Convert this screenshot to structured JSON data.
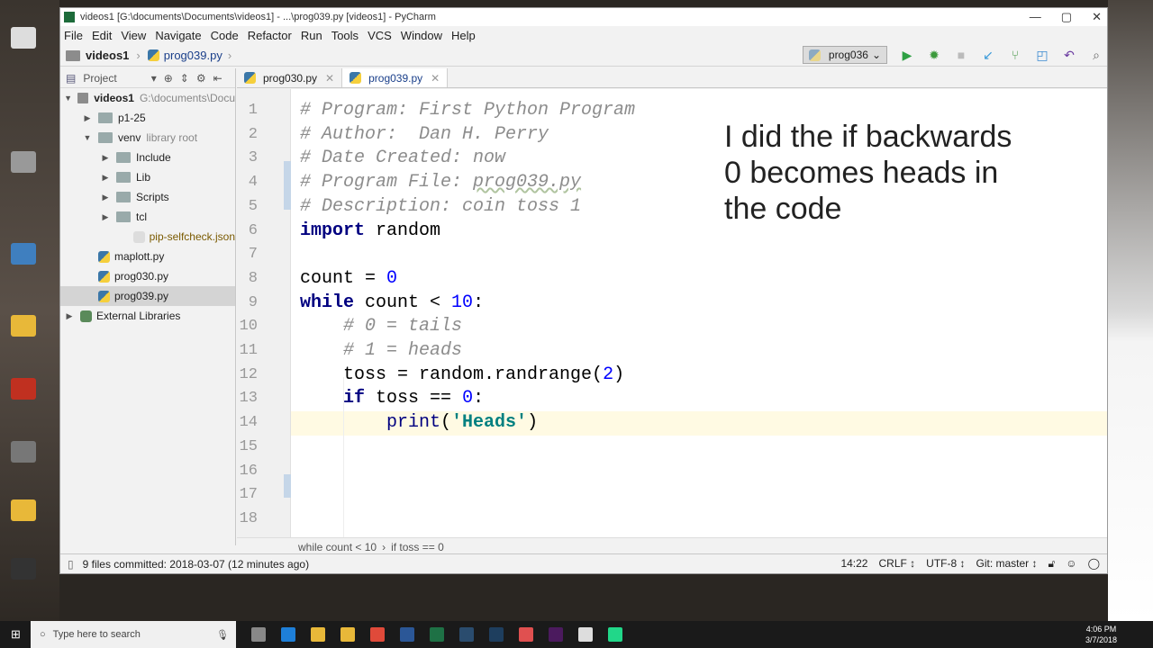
{
  "window": {
    "title": "videos1 [G:\\documents\\Documents\\videos1] - ...\\prog039.py [videos1] - PyCharm",
    "controls": [
      "—",
      "▢",
      "✕"
    ]
  },
  "menu": [
    "File",
    "Edit",
    "View",
    "Navigate",
    "Code",
    "Refactor",
    "Run",
    "Tools",
    "VCS",
    "Window",
    "Help"
  ],
  "nav": {
    "project": "videos1",
    "file": "prog039.py"
  },
  "toolbar": {
    "run_config": "prog036",
    "icons": [
      "run-icon",
      "debug-icon",
      "stop-icon",
      "vcs-update-icon",
      "vcs-commit-icon",
      "history-icon",
      "revert-icon",
      "search-icon"
    ]
  },
  "sidebar": {
    "title": "Project",
    "items": [
      {
        "label": "videos1",
        "hint": "G:\\documents\\Docu",
        "depth": 0,
        "arrow": "down",
        "type": "folder",
        "bold": true
      },
      {
        "label": "p1-25",
        "depth": 1,
        "arrow": "right",
        "type": "folder"
      },
      {
        "label": "venv",
        "hint": "library root",
        "depth": 1,
        "arrow": "down",
        "type": "folder"
      },
      {
        "label": "Include",
        "depth": 2,
        "arrow": "right",
        "type": "folder"
      },
      {
        "label": "Lib",
        "depth": 2,
        "arrow": "right",
        "type": "folder"
      },
      {
        "label": "Scripts",
        "depth": 2,
        "arrow": "right",
        "type": "folder"
      },
      {
        "label": "tcl",
        "depth": 2,
        "arrow": "right",
        "type": "folder"
      },
      {
        "label": "pip-selfcheck.json",
        "depth": 3,
        "type": "json",
        "color": "#7a5a00"
      },
      {
        "label": "maplott.py",
        "depth": 1,
        "type": "py"
      },
      {
        "label": "prog030.py",
        "depth": 1,
        "type": "py"
      },
      {
        "label": "prog039.py",
        "depth": 1,
        "type": "py",
        "selected": true
      },
      {
        "label": "External Libraries",
        "depth": 0,
        "arrow": "right",
        "type": "lib"
      }
    ]
  },
  "tabs": [
    {
      "label": "prog030.py",
      "active": false
    },
    {
      "label": "prog039.py",
      "active": true
    }
  ],
  "code": [
    [
      [
        "comment",
        "# Program: First Python Program"
      ]
    ],
    [
      [
        "comment",
        "# Author:  Dan H. Perry"
      ]
    ],
    [
      [
        "comment",
        "# Date Created: now"
      ]
    ],
    [
      [
        "comment",
        "# Program File: "
      ],
      [
        "comment under",
        "prog039.py"
      ]
    ],
    [
      [
        "comment",
        "# Description: coin toss 1"
      ]
    ],
    [
      [
        "kw",
        "import"
      ],
      [
        "plain",
        " random"
      ]
    ],
    [],
    [
      [
        "plain",
        "count = "
      ],
      [
        "num",
        "0"
      ]
    ],
    [
      [
        "kw",
        "while"
      ],
      [
        "plain",
        " count < "
      ],
      [
        "num",
        "10"
      ],
      [
        "plain",
        ":"
      ]
    ],
    [
      [
        "plain",
        "    "
      ],
      [
        "comment",
        "# 0 = tails"
      ]
    ],
    [
      [
        "plain",
        "    "
      ],
      [
        "comment",
        "# 1 = heads"
      ]
    ],
    [
      [
        "plain",
        "    toss = random.randrange("
      ],
      [
        "num",
        "2"
      ],
      [
        "plain",
        ")"
      ]
    ],
    [
      [
        "plain",
        "    "
      ],
      [
        "kw",
        "if"
      ],
      [
        "plain",
        " toss == "
      ],
      [
        "num",
        "0"
      ],
      [
        "plain",
        ":"
      ]
    ],
    [
      [
        "plain",
        "        "
      ],
      [
        "builtin",
        "print"
      ],
      [
        "plain",
        "("
      ],
      [
        "str",
        "'Heads'"
      ],
      [
        "plain",
        ")"
      ]
    ],
    [],
    [],
    [],
    []
  ],
  "current_line": 14,
  "annotation": [
    "I did the if backwards",
    "0 becomes heads in",
    "the code"
  ],
  "breadcrumb": [
    "while count < 10",
    "if toss == 0"
  ],
  "status": {
    "message": "9 files committed: 2018-03-07 (12 minutes ago)",
    "position": "14:22",
    "line_sep": "CRLF ↕",
    "encoding": "UTF-8 ↕",
    "vcs": "Git: master ↕"
  },
  "taskbar": {
    "search_placeholder": "Type here to search",
    "time": "4:06 PM",
    "date": "3/7/2018",
    "apps": [
      {
        "name": "task-view",
        "color": "#888"
      },
      {
        "name": "edge",
        "color": "#1e7fd8"
      },
      {
        "name": "file-explorer",
        "color": "#e8b839"
      },
      {
        "name": "store",
        "color": "#e8b839"
      },
      {
        "name": "chrome",
        "color": "#e04a3a"
      },
      {
        "name": "word",
        "color": "#2b5797"
      },
      {
        "name": "excel",
        "color": "#1e7145"
      },
      {
        "name": "lightroom",
        "color": "#2a4c6e"
      },
      {
        "name": "photoshop",
        "color": "#1e3e5e"
      },
      {
        "name": "app",
        "color": "#e05050"
      },
      {
        "name": "premiere",
        "color": "#4b1a5e"
      },
      {
        "name": "notes",
        "color": "#ddd"
      },
      {
        "name": "pycharm",
        "color": "#21d789"
      }
    ]
  }
}
